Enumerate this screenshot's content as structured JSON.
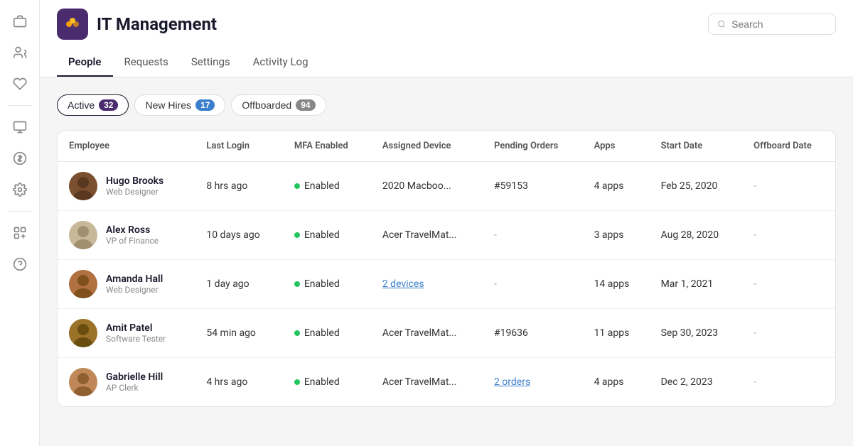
{
  "brand": {
    "logo_emoji": "🔶",
    "title": "IT Management"
  },
  "search": {
    "placeholder": "Search"
  },
  "nav_tabs": [
    {
      "id": "people",
      "label": "People",
      "active": true
    },
    {
      "id": "requests",
      "label": "Requests",
      "active": false
    },
    {
      "id": "settings",
      "label": "Settings",
      "active": false
    },
    {
      "id": "activity-log",
      "label": "Activity Log",
      "active": false
    }
  ],
  "filter_tabs": [
    {
      "id": "active",
      "label": "Active",
      "count": "32",
      "badge_color": "purple",
      "active": true
    },
    {
      "id": "new-hires",
      "label": "New Hires",
      "count": "17",
      "badge_color": "blue",
      "active": false
    },
    {
      "id": "offboarded",
      "label": "Offboarded",
      "count": "94",
      "badge_color": "grey",
      "active": false
    }
  ],
  "table": {
    "columns": [
      {
        "id": "employee",
        "label": "Employee"
      },
      {
        "id": "last-login",
        "label": "Last Login"
      },
      {
        "id": "mfa",
        "label": "MFA Enabled"
      },
      {
        "id": "device",
        "label": "Assigned Device"
      },
      {
        "id": "pending-orders",
        "label": "Pending Orders"
      },
      {
        "id": "apps",
        "label": "Apps"
      },
      {
        "id": "start-date",
        "label": "Start Date"
      },
      {
        "id": "offboard-date",
        "label": "Offboard Date"
      }
    ],
    "rows": [
      {
        "id": "hugo-brooks",
        "avatar_color": "#5a3e2b",
        "avatar_emoji": "👨🏿",
        "name": "Hugo Brooks",
        "role": "Web Designer",
        "last_login": "8 hrs ago",
        "mfa": "Enabled",
        "device": "2020 Macboo...",
        "pending_orders": "#59153",
        "apps": "4 apps",
        "start_date": "Feb 25, 2020",
        "offboard_date": "-"
      },
      {
        "id": "alex-ross",
        "avatar_color": "#d4c4a8",
        "avatar_emoji": "👨🏼",
        "name": "Alex Ross",
        "role": "VP of Finance",
        "last_login": "10 days ago",
        "mfa": "Enabled",
        "device": "Acer TravelMat...",
        "pending_orders": "-",
        "apps": "3 apps",
        "start_date": "Aug 28, 2020",
        "offboard_date": "-"
      },
      {
        "id": "amanda-hall",
        "avatar_color": "#c4956a",
        "avatar_emoji": "👩🏽",
        "name": "Amanda Hall",
        "role": "Web Designer",
        "last_login": "1 day ago",
        "mfa": "Enabled",
        "device_link": "2 devices",
        "pending_orders": "-",
        "apps": "14 apps",
        "start_date": "Mar 1, 2021",
        "offboard_date": "-"
      },
      {
        "id": "amit-patel",
        "avatar_color": "#8b6914",
        "avatar_emoji": "👨🏽",
        "name": "Amit Patel",
        "role": "Software Tester",
        "last_login": "54 min ago",
        "mfa": "Enabled",
        "device": "Acer TravelMat...",
        "pending_orders": "#19636",
        "apps": "11 apps",
        "start_date": "Sep 30, 2023",
        "offboard_date": "-"
      },
      {
        "id": "gabrielle-hill",
        "avatar_color": "#c4956a",
        "avatar_emoji": "👩🏽",
        "name": "Gabrielle Hill",
        "role": "AP Clerk",
        "last_login": "4 hrs ago",
        "mfa": "Enabled",
        "device": "Acer TravelMat...",
        "orders_link": "2 orders",
        "apps": "4 apps",
        "start_date": "Dec 2, 2023",
        "offboard_date": "-"
      }
    ]
  },
  "sidebar": {
    "icons": [
      {
        "id": "briefcase",
        "symbol": "💼"
      },
      {
        "id": "people",
        "symbol": "👤"
      },
      {
        "id": "heart",
        "symbol": "♡"
      },
      {
        "id": "monitor",
        "symbol": "🖥"
      },
      {
        "id": "dollar",
        "symbol": "💲"
      },
      {
        "id": "gear",
        "symbol": "⚙"
      },
      {
        "id": "add-apps",
        "symbol": "⊞"
      },
      {
        "id": "question",
        "symbol": "?"
      }
    ]
  }
}
